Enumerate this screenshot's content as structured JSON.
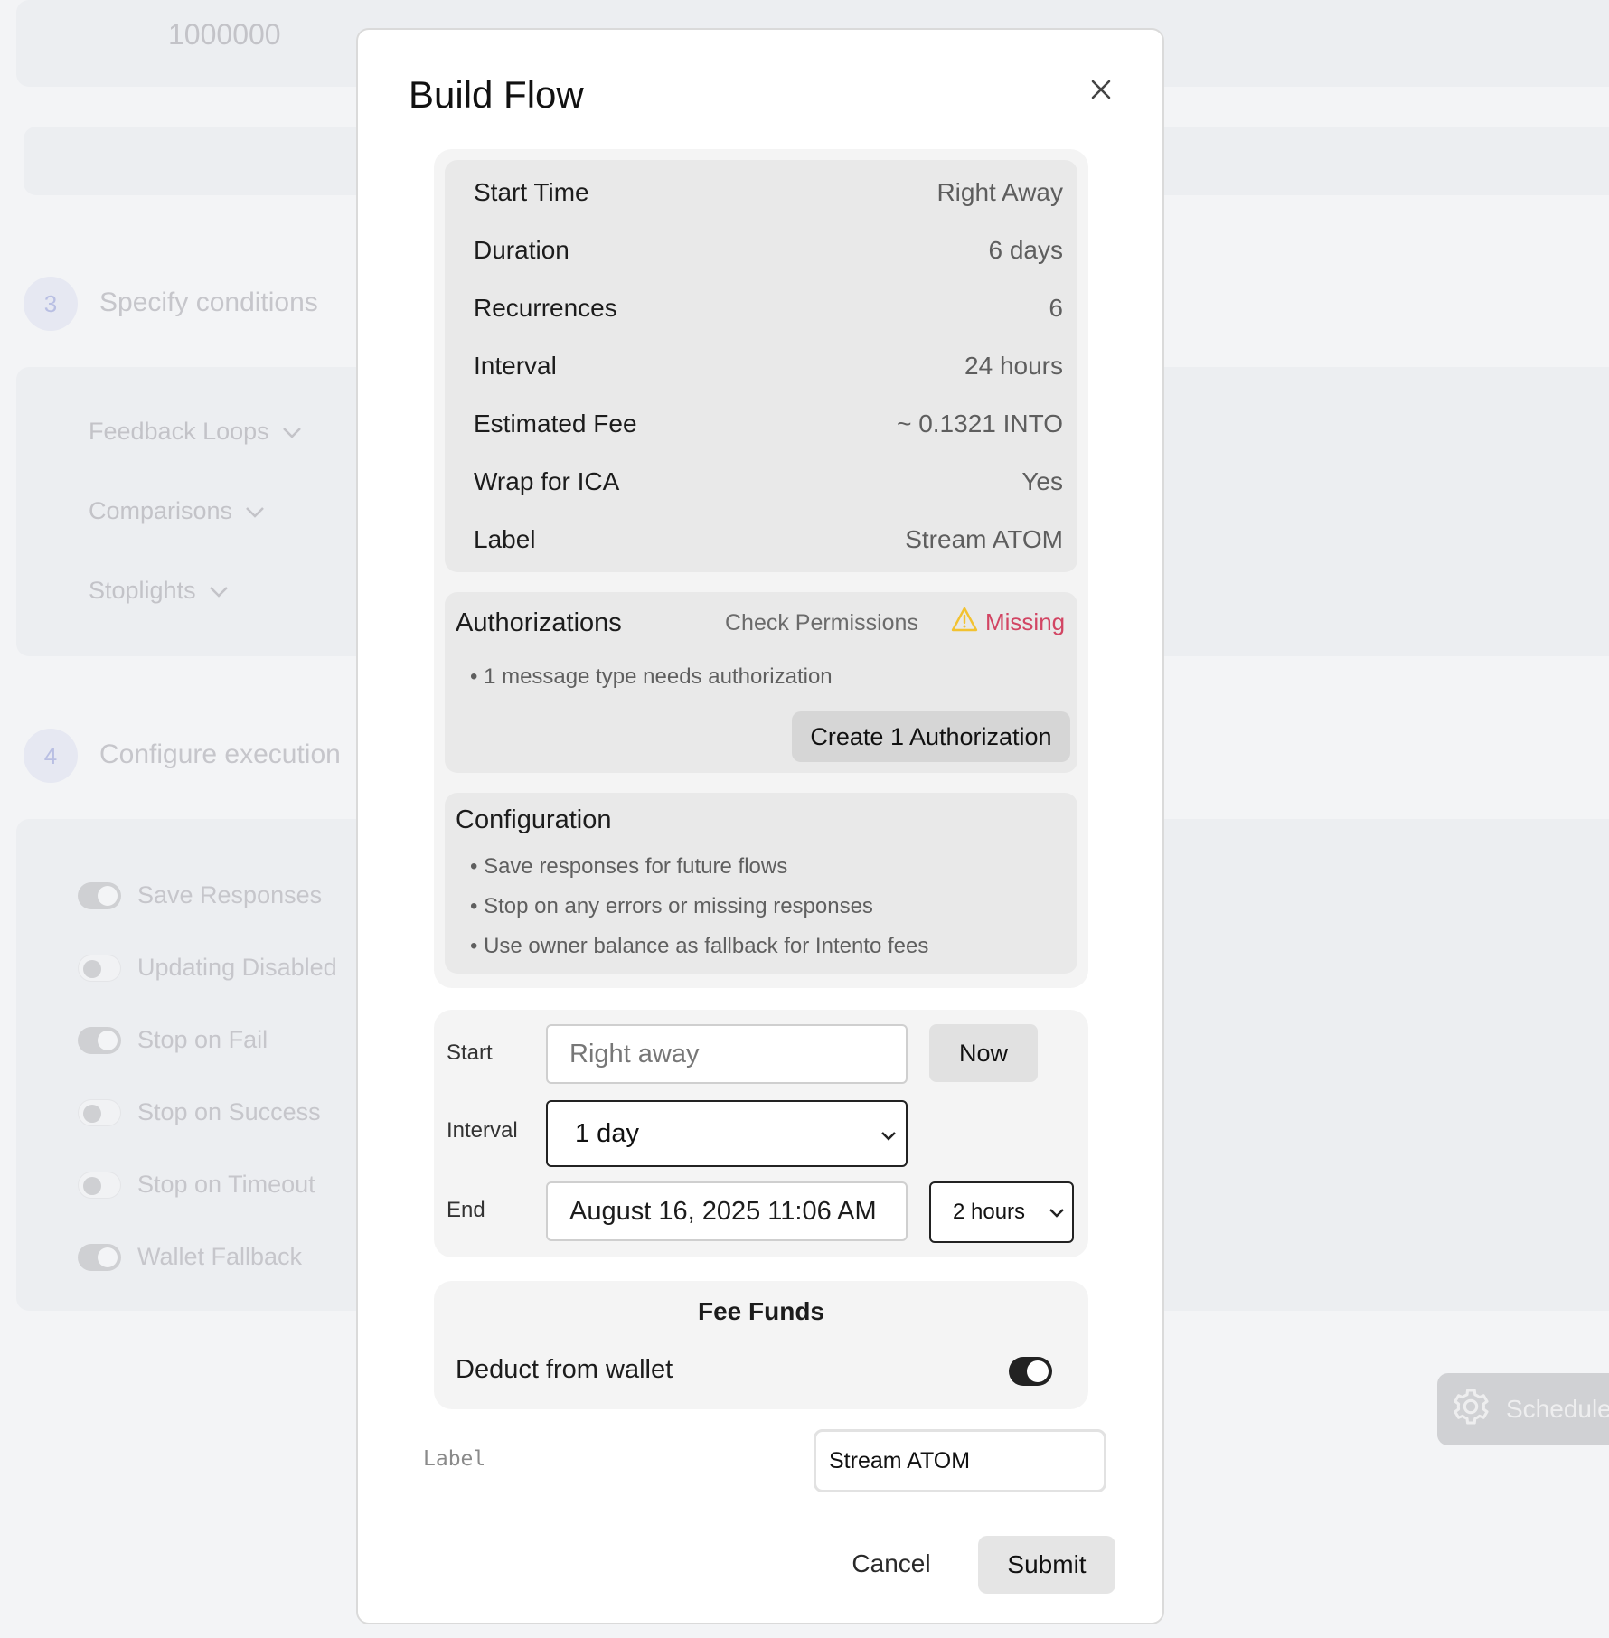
{
  "background": {
    "amount_value": "1000000",
    "steps": [
      {
        "number": "3",
        "title": "Specify conditions"
      },
      {
        "number": "4",
        "title": "Configure execution"
      }
    ],
    "condition_dropdowns": [
      "Feedback Loops",
      "Comparisons",
      "Stoplights"
    ],
    "toggles": [
      {
        "label": "Save Responses",
        "on": true
      },
      {
        "label": "Updating Disabled",
        "on": false
      },
      {
        "label": "Stop on Fail",
        "on": true
      },
      {
        "label": "Stop on Success",
        "on": false
      },
      {
        "label": "Stop on Timeout",
        "on": false
      },
      {
        "label": "Wallet Fallback",
        "on": true
      }
    ],
    "schedule_button_label": "Schedule"
  },
  "modal": {
    "title": "Build Flow",
    "summary": [
      {
        "label": "Start Time",
        "value": "Right Away"
      },
      {
        "label": "Duration",
        "value": "6 days"
      },
      {
        "label": "Recurrences",
        "value": "6"
      },
      {
        "label": "Interval",
        "value": "24 hours"
      },
      {
        "label": "Estimated Fee",
        "value": "~ 0.1321 INTO"
      },
      {
        "label": "Wrap for ICA",
        "value": "Yes"
      },
      {
        "label": "Label",
        "value": "Stream ATOM"
      }
    ],
    "authorizations": {
      "title": "Authorizations",
      "check_label": "Check Permissions",
      "status": "Missing",
      "status_color": "#d24563",
      "note": "• 1 message type needs authorization",
      "create_button": "Create 1 Authorization"
    },
    "configuration": {
      "title": "Configuration",
      "items": [
        "• Save responses for future flows",
        "• Stop on any errors or missing responses",
        "• Use owner balance as fallback for Intento fees"
      ]
    },
    "schedule": {
      "start_label": "Start",
      "start_placeholder": "Right away",
      "now_button": "Now",
      "interval_label": "Interval",
      "interval_value": "1 day",
      "end_label": "End",
      "end_value": "August 16, 2025 11:06 AM",
      "end_offset_value": "2 hours"
    },
    "fee_funds": {
      "title": "Fee Funds",
      "deduct_label": "Deduct from wallet",
      "deduct_on": true
    },
    "label_field": {
      "caption": "Label",
      "value": "Stream ATOM"
    },
    "cancel_button": "Cancel",
    "submit_button": "Submit"
  }
}
